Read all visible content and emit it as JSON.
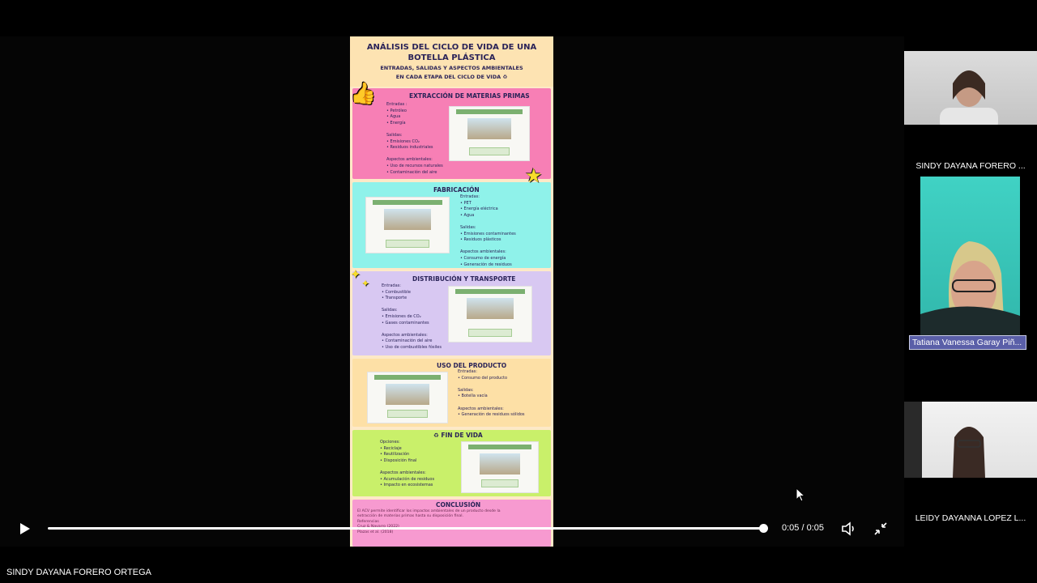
{
  "player": {
    "time": "0:05 / 0:05",
    "progress_fraction": 1.0,
    "presenter_name": "SINDY DAYANA FORERO ORTEGA"
  },
  "poster": {
    "title": "ANÁLISIS DEL CICLO DE VIDA DE UNA BOTELLA PLÁSTICA",
    "subtitle_1": "ENTRADAS, SALIDAS Y ASPECTOS AMBIENTALES",
    "subtitle_2": "EN CADA ETAPA DEL CICLO DE VIDA ♻",
    "sections": [
      {
        "title": "EXTRACCIÓN DE MATERIAS PRIMAS",
        "image_caption": "Extracción de Materias Primas",
        "text": "Entradas :\n• Petróleo\n• Agua\n• Energía\n\nSalidas:\n• Emisiones CO₂\n• Residuos industriales\n\nAspectos ambientales:\n• Uso de recursos naturales\n• Contaminación del aire",
        "color": "#f77fb5"
      },
      {
        "title": "FABRICACIÓN",
        "image_caption": "Fabricación",
        "text": "Entradas:\n• PET\n• Energía eléctrica\n• Agua\n\nSalidas:\n• Emisiones contaminantes\n• Residuos plásticos\n\nAspectos ambientales:\n• Consumo de energía\n• Generación de residuos",
        "color": "#8ff2ea"
      },
      {
        "title": "DISTRIBUCIÓN Y TRANSPORTE",
        "image_caption": "Distribución y Transporte",
        "text": "Entradas:\n• Combustible\n• Transporte\n\nSalidas:\n• Emisiones de CO₂\n• Gases contaminantes\n\nAspectos ambientales:\n• Contaminación del aire\n• Uso de combustibles fósiles",
        "color": "#d8c8f2"
      },
      {
        "title": "USO DEL PRODUCTO",
        "image_caption": "Uso del Producto",
        "text": "Entradas:\n• Consumo del producto\n\nSalidas:\n• Botella vacía\n\nAspectos ambientales:\n• Generación de residuos sólidos",
        "color": "#fde0a6"
      },
      {
        "title": "♻ FIN DE VIDA",
        "image_caption": "Fin de Vida",
        "text": "Opciones:\n• Reciclaje\n• Reutilización\n• Disposición final\n\nAspectos ambientales:\n• Acumulación de residuos\n• Impacto en ecosistemas",
        "color": "#c9f06a"
      },
      {
        "title": "CONCLUSIÓN",
        "text": "El ACV permite identificar los impactos ambientales de un producto desde la\nextracción de materias primas hasta su disposición final.\nReferencias\nCruz & Navarro (2022)\nPlazas et al. (2018)",
        "color": "#f79ad0"
      }
    ]
  },
  "participants": [
    {
      "name": "SINDY DAYANA FORERO ...",
      "highlighted": false
    },
    {
      "name": "Tatiana Vanessa Garay Piñ...",
      "highlighted": true
    },
    {
      "name": "LEIDY DAYANNA LOPEZ L...",
      "highlighted": false
    }
  ],
  "colors": {
    "background": "#000000",
    "speaker_label": "#5a5fa8",
    "progress": "#ffffff"
  },
  "icons": [
    "play-icon",
    "volume-icon",
    "exit-fullscreen-icon",
    "mouse-cursor-icon",
    "thumbs-up-icon",
    "star-icon",
    "sparkle-icon",
    "globe-icon"
  ]
}
